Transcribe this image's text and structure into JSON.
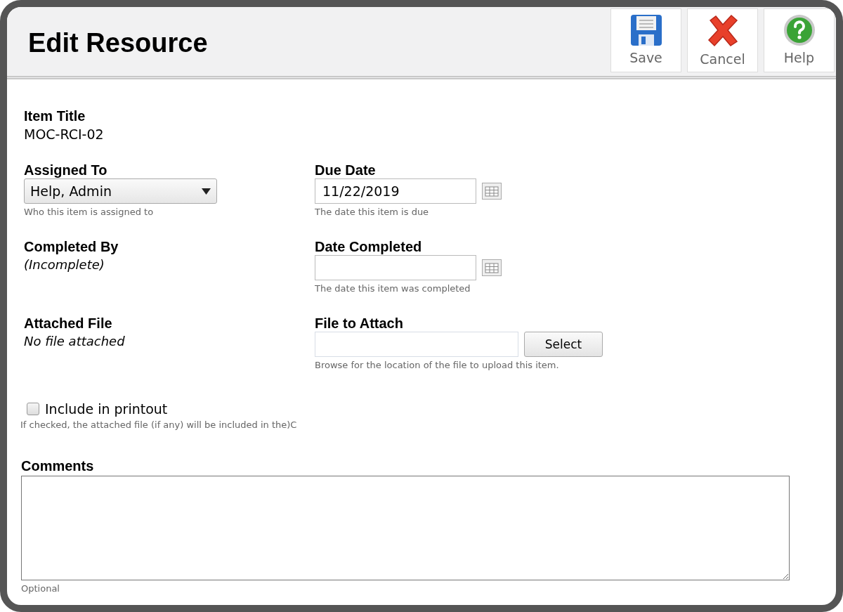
{
  "title": "Edit Resource",
  "toolbar": [
    {
      "kind": "save",
      "label": "Save"
    },
    {
      "kind": "cancel",
      "label": "Cancel"
    },
    {
      "kind": "help",
      "label": "Help"
    }
  ],
  "item_title": {
    "label": "Item Title",
    "value": "MOC-RCI-02"
  },
  "rows": [
    [
      {
        "kind": "select",
        "label": "Assigned To",
        "value": "Help, Admin",
        "hint": "Who this item is assigned to"
      },
      {
        "kind": "date",
        "label": "Due Date",
        "value": "11/22/2019",
        "hint": "The date this item is due"
      }
    ],
    [
      {
        "kind": "italic",
        "label": "Completed By",
        "value": "(Incomplete)"
      },
      {
        "kind": "date",
        "label": "Date Completed",
        "hint": "The date this item was completed"
      }
    ],
    [
      {
        "kind": "italic",
        "label": "Attached File",
        "value": "No file attached"
      },
      {
        "kind": "file",
        "label": "File to Attach",
        "button": "Select",
        "hint": "Browse for the location of the file to upload this item."
      }
    ]
  ],
  "include": {
    "label": "Include in printout",
    "checked": false,
    "hint": "If checked, the attached file (if any) will be included in the)C"
  },
  "comments": {
    "label": "Comments",
    "hint": "Optional"
  }
}
